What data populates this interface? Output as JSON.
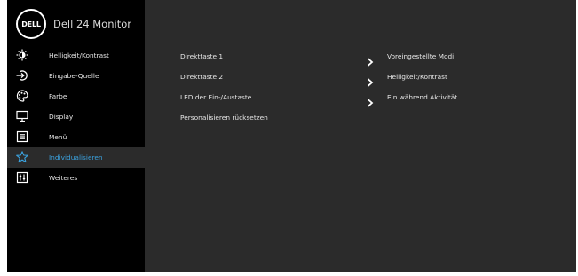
{
  "header": {
    "title": "Dell 24 Monitor",
    "logo_text": "DELL"
  },
  "sidebar": {
    "items": [
      {
        "label": "Helligkeit/Kontrast",
        "icon": "brightness-icon"
      },
      {
        "label": "Eingabe-Quelle",
        "icon": "input-source-icon"
      },
      {
        "label": "Farbe",
        "icon": "palette-icon"
      },
      {
        "label": "Display",
        "icon": "display-icon"
      },
      {
        "label": "Menü",
        "icon": "menu-icon"
      },
      {
        "label": "Individualisieren",
        "icon": "star-icon",
        "selected": true
      },
      {
        "label": "Weiteres",
        "icon": "others-icon"
      }
    ]
  },
  "settings": [
    {
      "label": "Direkttaste 1",
      "value": "Voreingestellte Modi"
    },
    {
      "label": "Direkttaste 2",
      "value": "Helligkeit/Kontrast"
    },
    {
      "label": "LED der Ein-/Austaste",
      "value": "Ein während Aktivität"
    },
    {
      "label": "Personalisieren rücksetzen",
      "value": ""
    }
  ],
  "colors": {
    "panel": "#2b2b2b",
    "sidebar": "#000000",
    "accent": "#3ba3e0",
    "text": "#e6e6e6"
  }
}
